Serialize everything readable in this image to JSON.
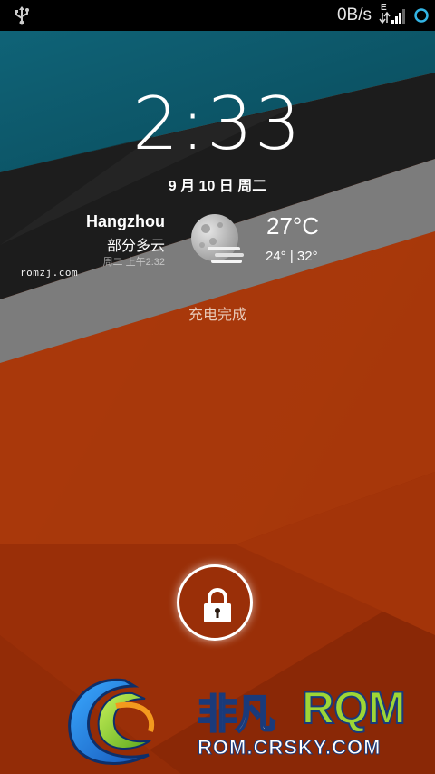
{
  "status_bar": {
    "usb_icon": "usb-icon",
    "net_speed": "0B/s",
    "network_type": "E",
    "signal_icon": "signal-icon",
    "sync_icon": "sync-circle-icon"
  },
  "clock": {
    "time": "2:33"
  },
  "date": "9 月 10 日 周二",
  "weather": {
    "city": "Hangzhou",
    "condition": "部分多云",
    "updated": "周二 上午2:32",
    "icon": "moon-cloudy-icon",
    "temperature": "27°C",
    "range": "24° | 32°"
  },
  "site_mark": "romzj.com",
  "charge_status": "充电完成",
  "lock": {
    "icon": "lock-icon"
  },
  "watermark": {
    "brand_cn": "非凡",
    "brand_rom": "RQM",
    "url": "ROM.CRSKY.COM"
  },
  "colors": {
    "teal": "#0d5a6e",
    "dark": "#1a1a1a",
    "gray": "#7d7d7d",
    "orange_red": "#a8330b"
  }
}
